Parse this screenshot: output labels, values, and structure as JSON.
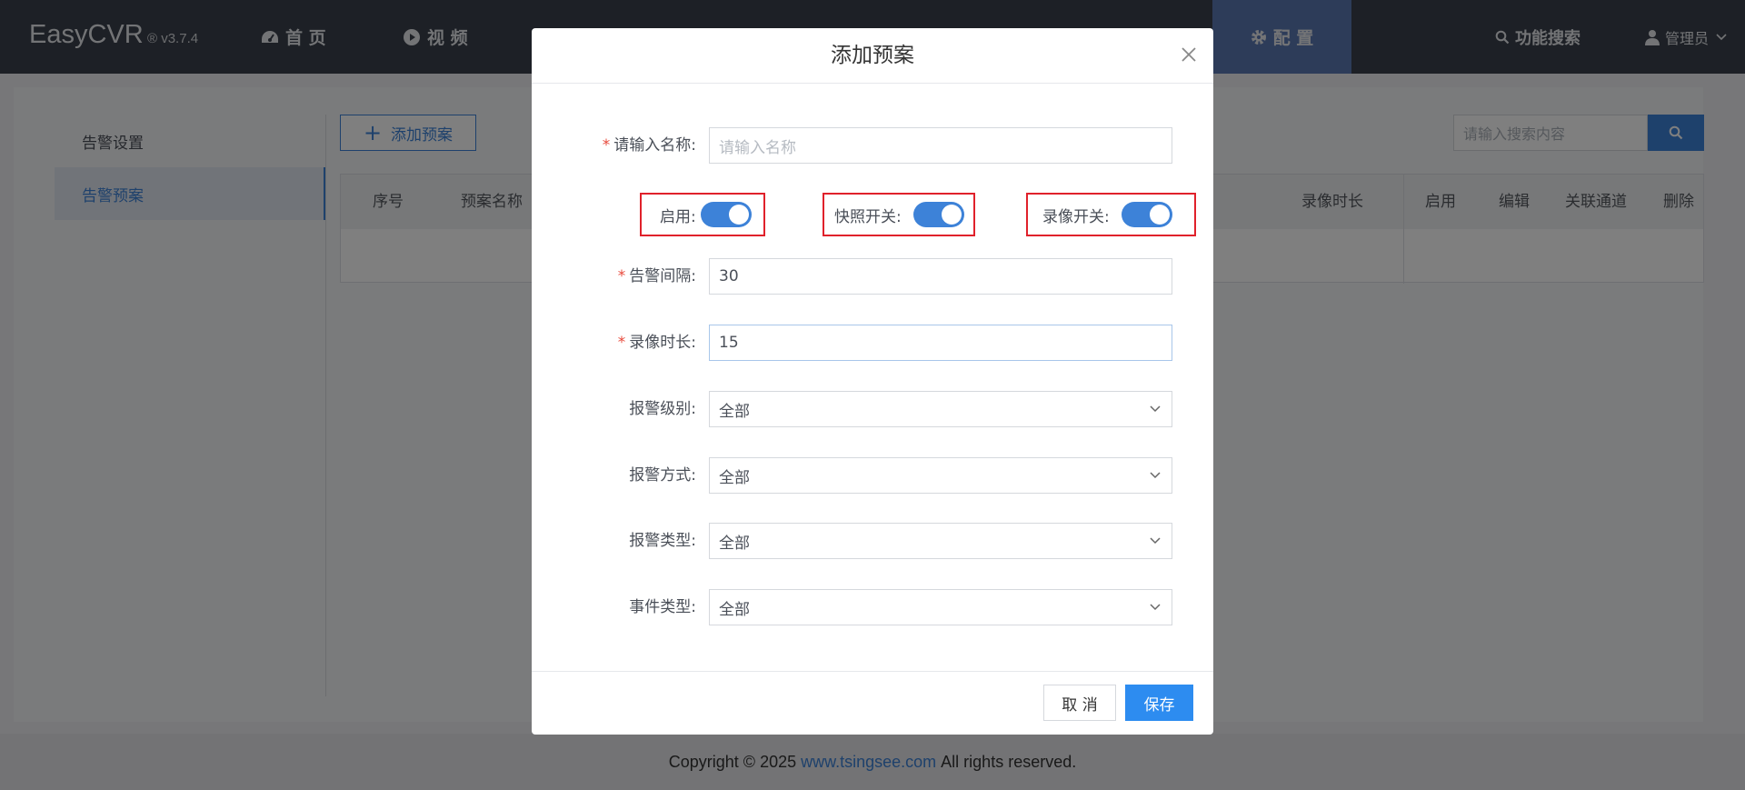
{
  "topbar": {
    "brand": "EasyCVR",
    "version": "® v3.7.4",
    "nav": [
      {
        "label": "首 页",
        "icon": "dashboard-icon"
      },
      {
        "label": "视 频",
        "icon": "play-circle-icon"
      },
      {
        "label": "配 置",
        "icon": "gear-icon"
      }
    ],
    "search_label": "功能搜索",
    "user_label": "管理员"
  },
  "sidebar": {
    "items": [
      {
        "label": "告警设置"
      },
      {
        "label": "告警预案",
        "active": true
      }
    ]
  },
  "toolbar": {
    "add_plan_label": "添加预案",
    "search_placeholder": "请输入搜索内容"
  },
  "table": {
    "columns": [
      "序号",
      "预案名称",
      "录像时长",
      "启用",
      "编辑",
      "关联通道",
      "删除"
    ]
  },
  "modal": {
    "title": "添加预案",
    "name_label": "请输入名称:",
    "name_placeholder": "请输入名称",
    "toggles": [
      {
        "label": "启用:",
        "on": true
      },
      {
        "label": "快照开关:",
        "on": true
      },
      {
        "label": "录像开关:",
        "on": true
      }
    ],
    "interval_label": "告警间隔:",
    "interval_value": "30",
    "duration_label": "录像时长:",
    "duration_value": "15",
    "selects": [
      {
        "label": "报警级别:",
        "value": "全部"
      },
      {
        "label": "报警方式:",
        "value": "全部"
      },
      {
        "label": "报警类型:",
        "value": "全部"
      },
      {
        "label": "事件类型:",
        "value": "全部"
      }
    ],
    "cancel_label": "取 消",
    "save_label": "保存"
  },
  "footer": {
    "prefix": "Copyright © 2025",
    "link": "www.tsingsee.com",
    "suffix": "All rights reserved."
  },
  "colors": {
    "accent": "#3d82d8",
    "primary_button": "#2d8cf0",
    "nav_bg": "#3a414c",
    "nav_active": "#5a78b3",
    "highlight_box": "#e0212b"
  }
}
